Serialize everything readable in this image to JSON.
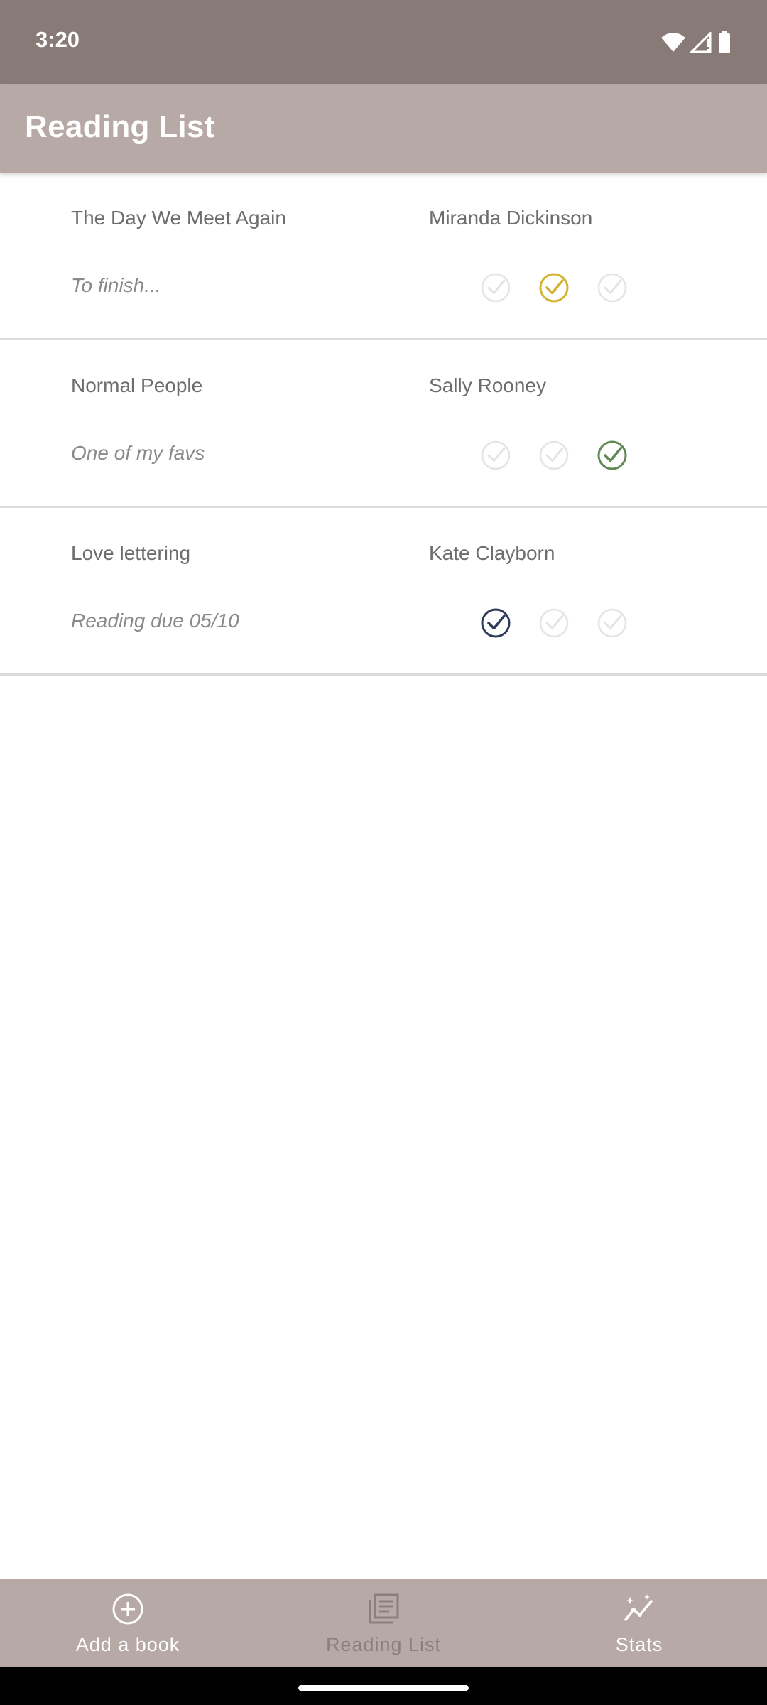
{
  "status_bar": {
    "time": "3:20",
    "icons": [
      "wifi-icon",
      "signal-icon",
      "battery-icon"
    ]
  },
  "app_bar": {
    "title": "Reading List",
    "color": "#b7a9a6"
  },
  "books": [
    {
      "title": "The Day We Meet Again",
      "author": "Miranda Dickinson",
      "note": "To finish...",
      "status_selected": 1
    },
    {
      "title": "Normal People",
      "author": "Sally Rooney",
      "note": "One of my favs",
      "status_selected": 2
    },
    {
      "title": "Love lettering",
      "author": "Kate Clayborn",
      "note": "Reading due 05/10",
      "status_selected": 0
    }
  ],
  "status_colors": [
    "#2d3a5a",
    "#d4b234",
    "#5f8a55"
  ],
  "inactive_check_color": "#e4e4e4",
  "bottom_nav": {
    "items": [
      {
        "label": "Add a book",
        "icon": "add-circle-icon"
      },
      {
        "label": "Reading List",
        "icon": "list-icon",
        "active": true
      },
      {
        "label": "Stats",
        "icon": "stats-icon"
      }
    ]
  }
}
